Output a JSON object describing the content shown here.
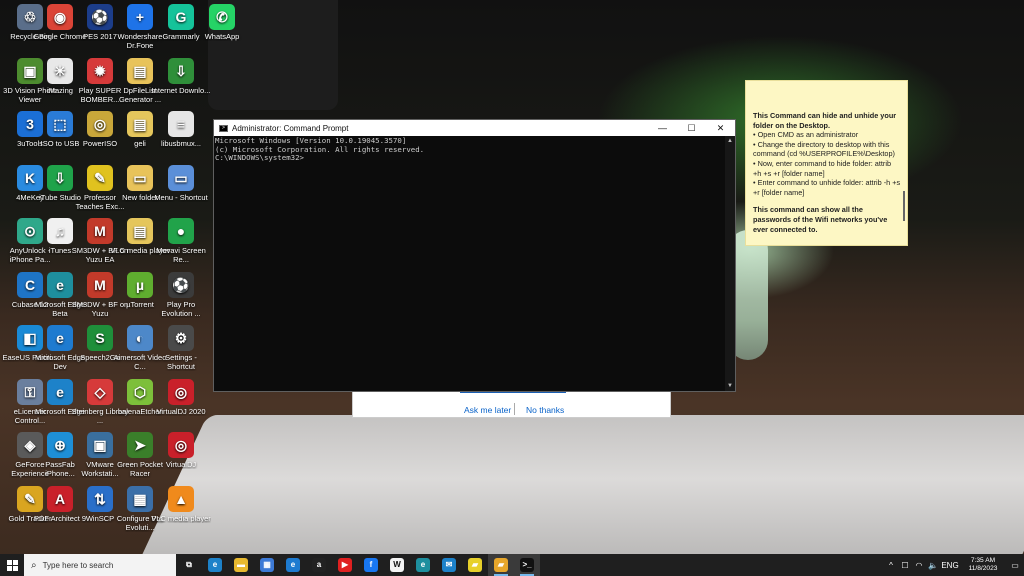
{
  "desktop_icons": [
    {
      "label": "Recycle Bin",
      "icon": "recycle-bin-icon",
      "color": "#5a6e8a",
      "glyph": "♲",
      "col": 0,
      "row": 0
    },
    {
      "label": "Google Chrome",
      "icon": "chrome-icon",
      "color": "#db4437",
      "glyph": "◉",
      "col": 1,
      "row": 0
    },
    {
      "label": "PES 2017",
      "icon": "pes-icon",
      "color": "#1c3d8a",
      "glyph": "⚽",
      "col": 2,
      "row": 0
    },
    {
      "label": "Wondershare Dr.Fone",
      "icon": "drfone-icon",
      "color": "#1e73e8",
      "glyph": "+",
      "col": 3,
      "row": 0
    },
    {
      "label": "Grammarly",
      "icon": "grammarly-icon",
      "color": "#15c39a",
      "glyph": "G",
      "col": 4,
      "row": 0
    },
    {
      "label": "WhatsApp",
      "icon": "whatsapp-icon",
      "color": "#25d366",
      "glyph": "✆",
      "col": 5,
      "row": 0
    },
    {
      "label": "3D Vision Photo Viewer",
      "icon": "3d-vision-icon",
      "color": "#4d8c2f",
      "glyph": "▣",
      "col": 0,
      "row": 1
    },
    {
      "label": "iMazing",
      "icon": "imazing-icon",
      "color": "#e8e8e8",
      "glyph": "✳",
      "col": 1,
      "row": 1
    },
    {
      "label": "Play SUPER BOMBER...",
      "icon": "bomber-icon",
      "color": "#d63a3a",
      "glyph": "✹",
      "col": 2,
      "row": 1
    },
    {
      "label": "DpFileList Generator ...",
      "icon": "folder-icon",
      "color": "#e8c35a",
      "glyph": "▤",
      "col": 3,
      "row": 1
    },
    {
      "label": "Internet Downlo...",
      "icon": "idm-icon",
      "color": "#2f8f3a",
      "glyph": "⇩",
      "col": 4,
      "row": 1
    },
    {
      "label": "3uTools",
      "icon": "3utools-icon",
      "color": "#1b6fd6",
      "glyph": "3",
      "col": 0,
      "row": 2
    },
    {
      "label": "ISO to USB",
      "icon": "iso-usb-icon",
      "color": "#2a7bd6",
      "glyph": "⬚",
      "col": 1,
      "row": 2
    },
    {
      "label": "PowerISO",
      "icon": "poweriso-icon",
      "color": "#c9a73a",
      "glyph": "◎",
      "col": 2,
      "row": 2
    },
    {
      "label": "geli",
      "icon": "file-icon",
      "color": "#e5c65c",
      "glyph": "▤",
      "col": 3,
      "row": 2
    },
    {
      "label": "libusbmux...",
      "icon": "file-icon",
      "color": "#e6e6e6",
      "glyph": "≡",
      "col": 4,
      "row": 2
    },
    {
      "label": "4MeKey",
      "icon": "4mekey-icon",
      "color": "#2a8be0",
      "glyph": "K",
      "col": 0,
      "row": 3
    },
    {
      "label": "iTube Studio",
      "icon": "itube-icon",
      "color": "#1fa34a",
      "glyph": "⇩",
      "col": 1,
      "row": 3
    },
    {
      "label": "Professor Teaches Exc...",
      "icon": "professor-icon",
      "color": "#e0c21f",
      "glyph": "✎",
      "col": 2,
      "row": 3
    },
    {
      "label": "New folder",
      "icon": "folder-icon",
      "color": "#e8c35a",
      "glyph": "▭",
      "col": 3,
      "row": 3
    },
    {
      "label": "Menu - Shortcut",
      "icon": "monitor-icon",
      "color": "#5b8fd8",
      "glyph": "▭",
      "col": 4,
      "row": 3
    },
    {
      "label": "AnyUnlock - iPhone Pa...",
      "icon": "anyunlock-icon",
      "color": "#2fa88a",
      "glyph": "⊙",
      "col": 0,
      "row": 4
    },
    {
      "label": "iTunes",
      "icon": "itunes-icon",
      "color": "#f0f0f0",
      "glyph": "♫",
      "col": 1,
      "row": 4
    },
    {
      "label": "SM3DW + BF on Yuzu EA",
      "icon": "mario-icon",
      "color": "#c23a2a",
      "glyph": "M",
      "col": 2,
      "row": 4
    },
    {
      "label": "VLC media player",
      "icon": "file-icon",
      "color": "#e5c65c",
      "glyph": "▤",
      "col": 3,
      "row": 4
    },
    {
      "label": "Movavi Screen Re...",
      "icon": "movavi-icon",
      "color": "#21a34a",
      "glyph": "●",
      "col": 4,
      "row": 4
    },
    {
      "label": "Cubase 12",
      "icon": "cubase-icon",
      "color": "#1e74c6",
      "glyph": "C",
      "col": 0,
      "row": 5
    },
    {
      "label": "Microsoft Edge Beta",
      "icon": "edge-beta-icon",
      "color": "#1e8f9e",
      "glyph": "e",
      "col": 1,
      "row": 5
    },
    {
      "label": "SM3DW + BF on Yuzu",
      "icon": "mario-icon",
      "color": "#c23a2a",
      "glyph": "M",
      "col": 2,
      "row": 5
    },
    {
      "label": "µTorrent",
      "icon": "utorrent-icon",
      "color": "#5fae2f",
      "glyph": "µ",
      "col": 3,
      "row": 5
    },
    {
      "label": "Play Pro Evolution ...",
      "icon": "pes-icon",
      "color": "#3b3b3b",
      "glyph": "⚽",
      "col": 4,
      "row": 5
    },
    {
      "label": "EaseUS Partiti...",
      "icon": "easeus-icon",
      "color": "#1a8ad6",
      "glyph": "◧",
      "col": 0,
      "row": 6
    },
    {
      "label": "Microsoft Edge Dev",
      "icon": "edge-dev-icon",
      "color": "#1e7bd0",
      "glyph": "e",
      "col": 1,
      "row": 6
    },
    {
      "label": "Speech2Go",
      "icon": "speech2go-icon",
      "color": "#1f8f3a",
      "glyph": "S",
      "col": 2,
      "row": 6
    },
    {
      "label": "Aimersoft Video C...",
      "icon": "aimersoft-icon",
      "color": "#4d88c9",
      "glyph": "◐",
      "col": 3,
      "row": 6
    },
    {
      "label": "Settings - Shortcut",
      "icon": "settings-icon",
      "color": "#4a4a4a",
      "glyph": "⚙",
      "col": 4,
      "row": 6
    },
    {
      "label": "eLicenser Control...",
      "icon": "elicenser-icon",
      "color": "#6a7f9e",
      "glyph": "⚿",
      "col": 0,
      "row": 7
    },
    {
      "label": "Microsoft Edge",
      "icon": "edge-icon",
      "color": "#1d82c9",
      "glyph": "e",
      "col": 1,
      "row": 7
    },
    {
      "label": "Steinberg Library ...",
      "icon": "steinberg-icon",
      "color": "#d63a3a",
      "glyph": "◇",
      "col": 2,
      "row": 7
    },
    {
      "label": "balenaEtcher",
      "icon": "balena-icon",
      "color": "#7dbf3a",
      "glyph": "⬡",
      "col": 3,
      "row": 7
    },
    {
      "label": "VirtualDJ 2020",
      "icon": "virtualdj-icon",
      "color": "#c9202a",
      "glyph": "◎",
      "col": 4,
      "row": 7
    },
    {
      "label": "GeForce Experience",
      "icon": "geforce-icon",
      "color": "#5a5a5a",
      "glyph": "◈",
      "col": 0,
      "row": 8
    },
    {
      "label": "PassFab iPhone...",
      "icon": "passfab-icon",
      "color": "#1e8fd6",
      "glyph": "⊕",
      "col": 1,
      "row": 8
    },
    {
      "label": "VMware Workstati...",
      "icon": "vmware-icon",
      "color": "#3a6f9e",
      "glyph": "▣",
      "col": 2,
      "row": 8
    },
    {
      "label": "Green Pocket Racer",
      "icon": "racer-icon",
      "color": "#3a7f2a",
      "glyph": "➤",
      "col": 3,
      "row": 8
    },
    {
      "label": "VirtualDJ",
      "icon": "virtualdj-icon",
      "color": "#c9202a",
      "glyph": "◎",
      "col": 4,
      "row": 8
    },
    {
      "label": "Gold Tracker",
      "icon": "goldtracker-icon",
      "color": "#d9a520",
      "glyph": "✎",
      "col": 0,
      "row": 9
    },
    {
      "label": "PDF Architect 9",
      "icon": "pdf-icon",
      "color": "#c9202a",
      "glyph": "A",
      "col": 1,
      "row": 9
    },
    {
      "label": "WinSCP",
      "icon": "winscp-icon",
      "color": "#2a6fc9",
      "glyph": "⇅",
      "col": 2,
      "row": 9
    },
    {
      "label": "Configure Pro Evoluti...",
      "icon": "configure-icon",
      "color": "#3b6fa8",
      "glyph": "▦",
      "col": 3,
      "row": 9
    },
    {
      "label": "VLC media player",
      "icon": "vlc-icon",
      "color": "#f08a1c",
      "glyph": "▲",
      "col": 4,
      "row": 9
    }
  ],
  "sticky_note": {
    "heading1": "This Command can hide and unhide your folder on the Desktop.",
    "bullets": [
      "• Open CMD as an administrator",
      "• Change the directory to desktop with this command (cd %USERPROFILE%\\Desktop)",
      "• Now, enter command to hide folder: attrib +h +s +r [folder name]",
      "• Enter command to unhide folder: attrib -h +s +r [folder name]"
    ],
    "heading2": "This command can show all the passwords of the Wifi networks you've ever connected to."
  },
  "cmd_window": {
    "title": "Administrator: Command Prompt",
    "line1": "Microsoft Windows [Version 10.0.19045.3570]",
    "line2": "(c) Microsoft Corporation. All rights reserved.",
    "line3": "",
    "line4": "C:\\WINDOWS\\system32>",
    "minimize": "—",
    "maximize": "☐",
    "close": "✕"
  },
  "behind_dialog": {
    "ask_later": "Ask me later",
    "no_thanks": "No thanks"
  },
  "taskbar": {
    "search_placeholder": "Type here to search",
    "pinned": [
      {
        "name": "task-view-icon",
        "glyph": "⧉",
        "color": "#1f1f1f"
      },
      {
        "name": "edge-taskbar-icon",
        "glyph": "e",
        "color": "#1d82c9"
      },
      {
        "name": "file-explorer-icon",
        "glyph": "▬",
        "color": "#e8b92f"
      },
      {
        "name": "store-icon",
        "glyph": "▦",
        "color": "#3d7ad6"
      },
      {
        "name": "edge-dev-taskbar-icon",
        "glyph": "e",
        "color": "#1e7bd0"
      },
      {
        "name": "amazon-icon",
        "glyph": "a",
        "color": "#222222"
      },
      {
        "name": "youtube-icon",
        "glyph": "▶",
        "color": "#e02020"
      },
      {
        "name": "facebook-icon",
        "glyph": "f",
        "color": "#1877f2"
      },
      {
        "name": "wikipedia-icon",
        "glyph": "W",
        "color": "#f4f4f4"
      },
      {
        "name": "edge-beta-taskbar-icon",
        "glyph": "e",
        "color": "#1e8f9e"
      },
      {
        "name": "mail-icon",
        "glyph": "✉",
        "color": "#1d82c9"
      },
      {
        "name": "sticky-notes-icon",
        "glyph": "▰",
        "color": "#e7d02a"
      },
      {
        "name": "sticky-notes-active-icon",
        "glyph": "▰",
        "color": "#e7a62a"
      },
      {
        "name": "cmd-taskbar-icon",
        "glyph": ">_",
        "color": "#111111"
      }
    ],
    "tray": {
      "chevron": "^",
      "network": "☐",
      "wifi": "◠",
      "volume": "🔈",
      "language": "ENG",
      "time": "7:35 AM",
      "date": "11/8/2023",
      "notifications": "▭"
    }
  }
}
